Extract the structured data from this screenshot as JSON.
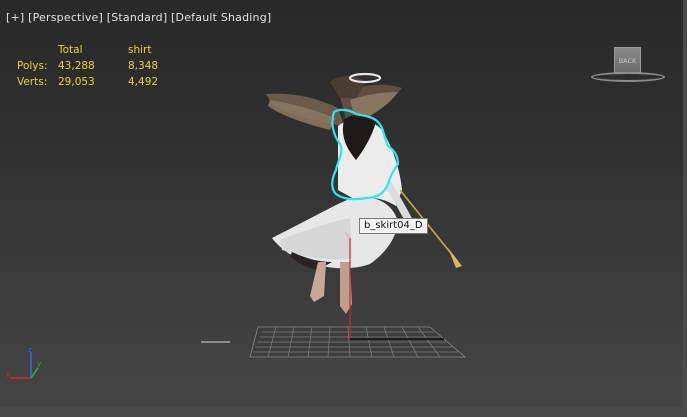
{
  "viewport": {
    "labels": [
      "[+]",
      "[Perspective]",
      "[Standard]",
      "[Default Shading]"
    ]
  },
  "stats": {
    "headers": [
      "",
      "Total",
      "shirt"
    ],
    "rows": [
      {
        "label": "Polys:",
        "total": "43,288",
        "selected": "8,348"
      },
      {
        "label": "Verts:",
        "total": "29,053",
        "selected": "4,492"
      }
    ]
  },
  "tooltip": {
    "text": "b_skirt04_D"
  },
  "viewcube": {
    "face_label": "BACK"
  },
  "axis": {
    "x": "x",
    "y": "y",
    "z": "z"
  },
  "colors": {
    "stats_text": "#e6d43a",
    "selection_outline": "#2ee6f0",
    "axis_x": "#d12a2a",
    "axis_y": "#2bb52b",
    "axis_z": "#3a63e0"
  }
}
